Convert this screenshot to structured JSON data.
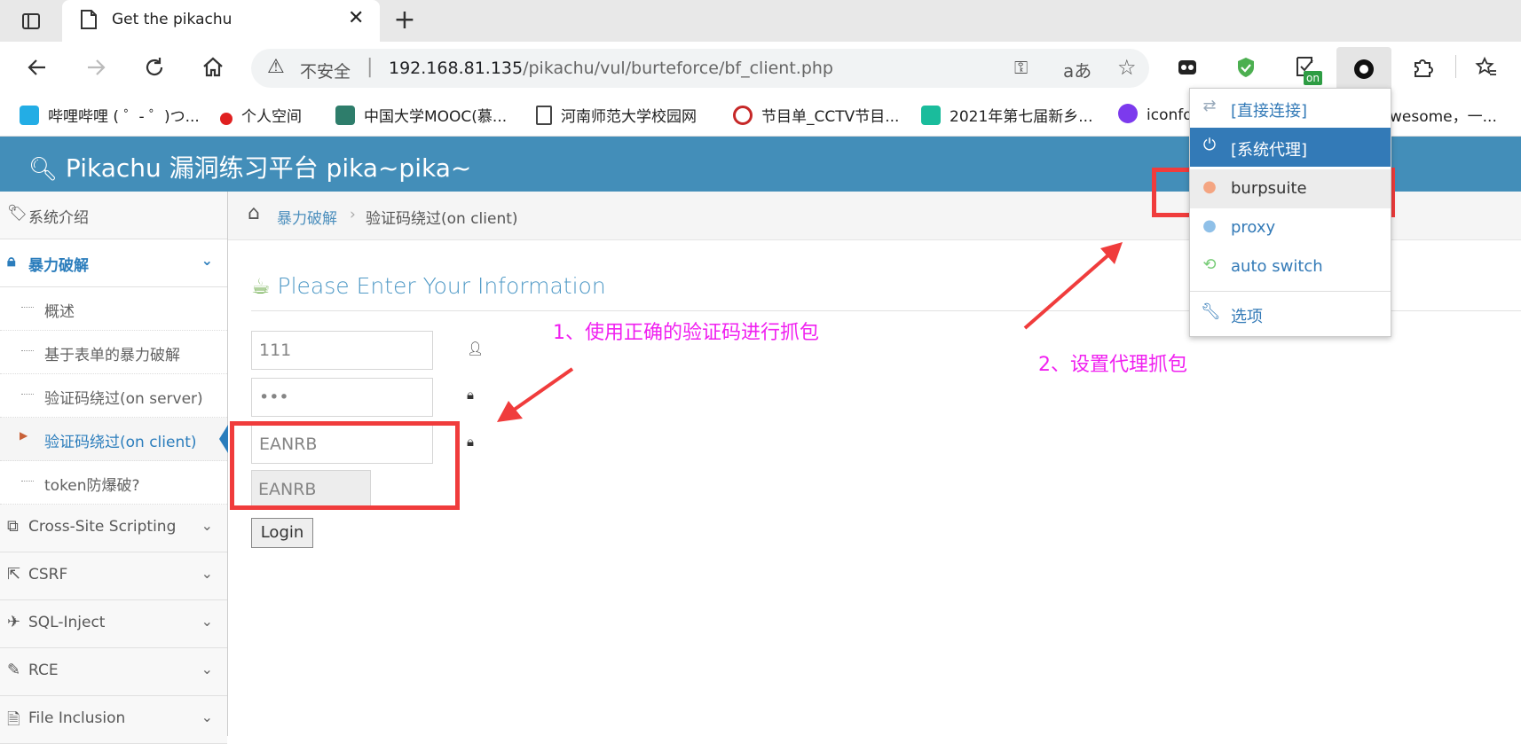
{
  "browser": {
    "tab_title": "Get the pikachu",
    "url_warning": "不安全",
    "url_host": "192.168.81.135",
    "url_path": "/pikachu/vul/burteforce/bf_client.php",
    "bookmarks": [
      {
        "label": "哔哩哔哩 ( ゜- ゜)つ...",
        "color": "#23ade5"
      },
      {
        "label": "个人空间",
        "color": "#e02020"
      },
      {
        "label": "中国大学MOOC(慕...",
        "color": "#2e7d6b"
      },
      {
        "label": "河南师范大学校园网",
        "color": "#666666"
      },
      {
        "label": "节目单_CCTV节目...",
        "color": "#c62828"
      },
      {
        "label": "2021年第七届新乡...",
        "color": "#1abc9c"
      },
      {
        "label": "iconfo",
        "color": "#7c3aed"
      },
      {
        "label": "wesome，一...",
        "color": "#ffffff"
      }
    ],
    "extension_badge": "on"
  },
  "app": {
    "title": "Pikachu 漏洞练习平台 pika~pika~"
  },
  "sidebar": {
    "items": [
      {
        "label": "系统介绍",
        "icon": "tag-icon"
      },
      {
        "label": "暴力破解",
        "icon": "lock-icon",
        "active": true
      },
      {
        "label": "Cross-Site Scripting",
        "icon": "code-icon"
      },
      {
        "label": "CSRF",
        "icon": "share-icon"
      },
      {
        "label": "SQL-Inject",
        "icon": "plane-icon"
      },
      {
        "label": "RCE",
        "icon": "pencil-icon"
      },
      {
        "label": "File Inclusion",
        "icon": "file-icon"
      }
    ],
    "subitems": [
      {
        "label": "概述"
      },
      {
        "label": "基于表单的暴力破解"
      },
      {
        "label": "验证码绕过(on server)"
      },
      {
        "label": "验证码绕过(on client)",
        "active": true
      },
      {
        "label": "token防爆破?"
      }
    ]
  },
  "breadcrumb": {
    "parent": "暴力破解",
    "current": "验证码绕过(on client)"
  },
  "form": {
    "title": "Please Enter Your Information",
    "username": "111",
    "password": "•••",
    "captcha_input": "EANRB",
    "captcha_display": "EANRB",
    "login_label": "Login"
  },
  "annotations": {
    "step1": "1、使用正确的验证码进行抓包",
    "step2": "2、设置代理抓包",
    "color": "#f020f0",
    "box_color": "#f03c3c"
  },
  "proxy_menu": {
    "items": [
      {
        "label": "[直接连接]",
        "icon": "arrows-icon",
        "icon_color": "#99aabb"
      },
      {
        "label": "[系统代理]",
        "icon": "power-icon",
        "selected": true
      },
      {
        "label": "burpsuite",
        "icon": "globe-icon",
        "icon_color": "#f4a582"
      },
      {
        "label": "proxy",
        "icon": "globe-icon",
        "icon_color": "#8fc0e8"
      },
      {
        "label": "auto switch",
        "icon": "retweet-icon",
        "icon_color": "#77cc77"
      },
      {
        "label": "选项",
        "icon": "wrench-icon"
      }
    ]
  }
}
